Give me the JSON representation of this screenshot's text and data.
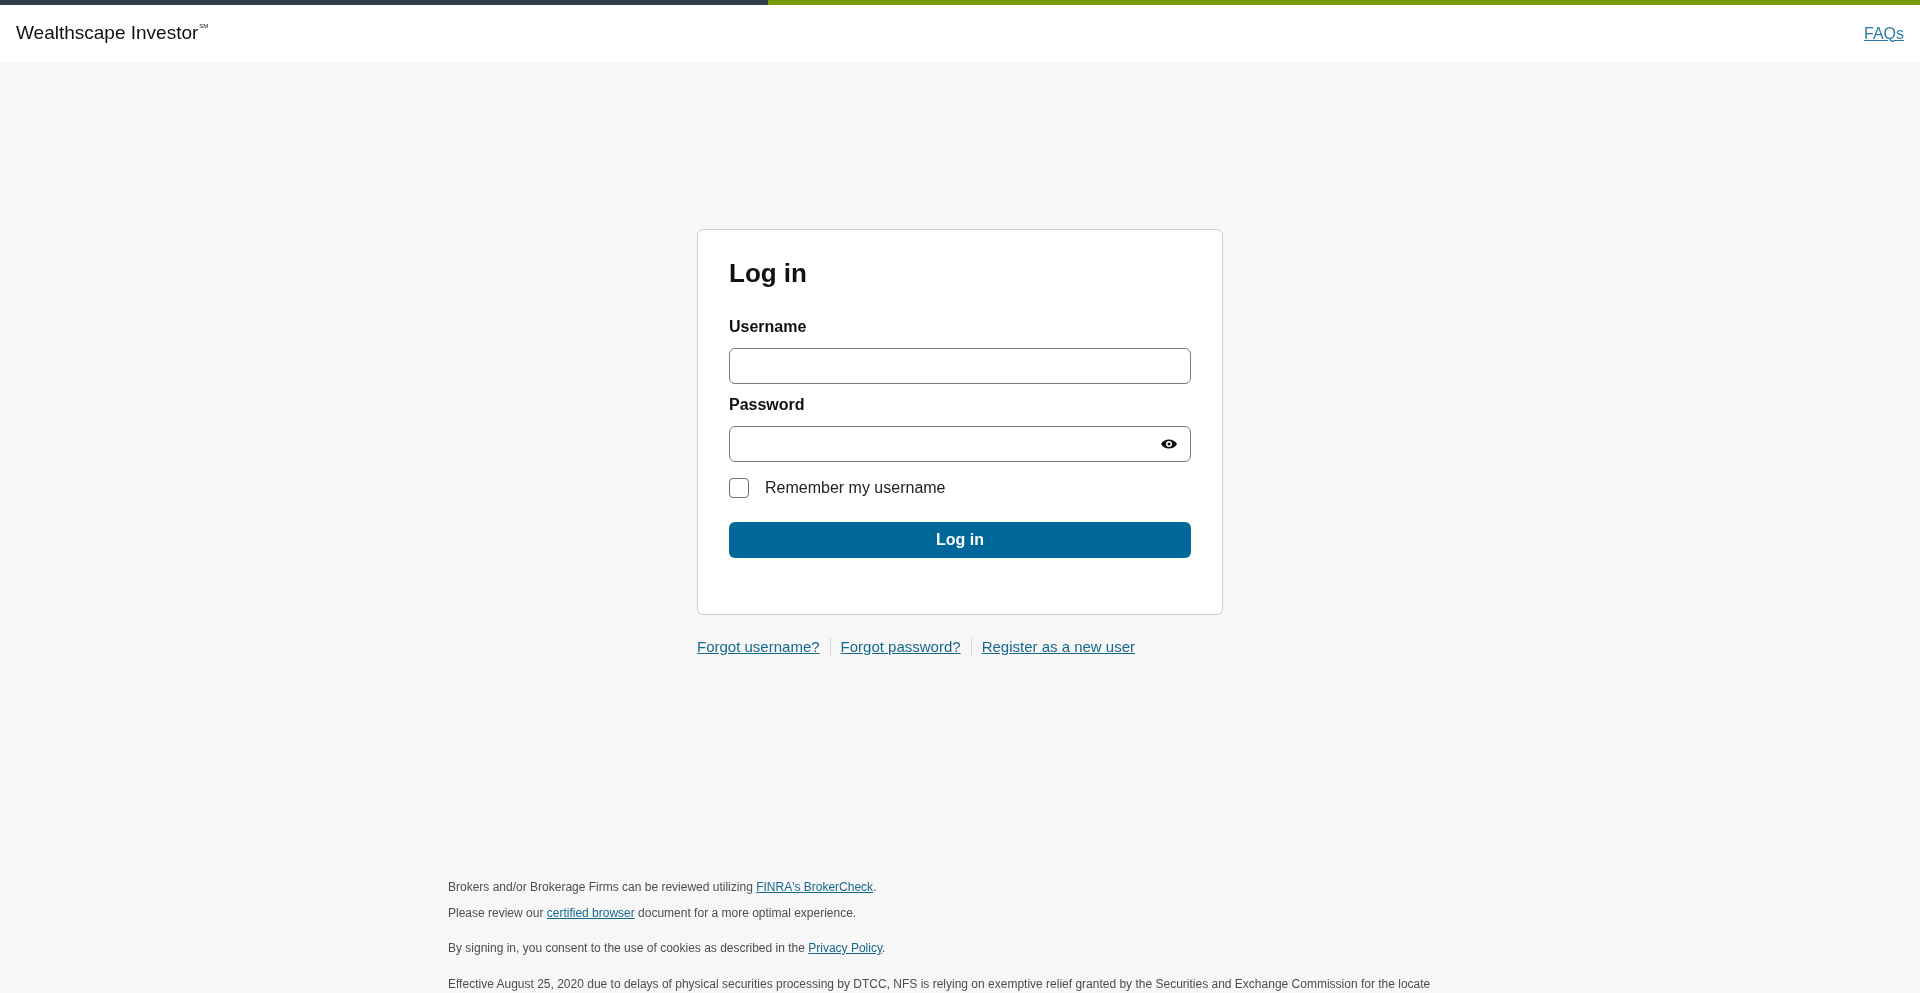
{
  "header": {
    "logo": "Wealthscape Investor$^{SM}$",
    "faq_link": "FAQs"
  },
  "login_form": {
    "title": "Log in",
    "fields": [
      {
        "label": "Username",
        "kind": "text"
      },
      {
        "label": "Password",
        "kind": "password"
      }
    ],
    "remember": {
      "label": "Remember my username",
      "checked": false
    },
    "submit": "Log in"
  },
  "links": [
    "Forgot username?",
    "Forgot password?",
    "Register as a new user"
  ],
  "footer": {
    "paragraphs": [
      {
        "before": "Brokers and/or Brokerage Firms can be reviewed utilizing ",
        "link": "FINRA's BrokerCheck",
        "after": "."
      },
      {
        "before": "Please review our ",
        "link": "certified browser",
        "after": " document for a more optimal experience."
      },
      {
        "before": "By signing in, you consent to the use of cookies as described in the ",
        "link": "Privacy Policy",
        "after": "."
      },
      {
        "before": "Effective August 25, 2020 due to delays of physical securities processing by DTCC, NFS is relying on exemptive relief granted by the Securities and Exchange Commission for the locate"
      }
    ]
  }
}
